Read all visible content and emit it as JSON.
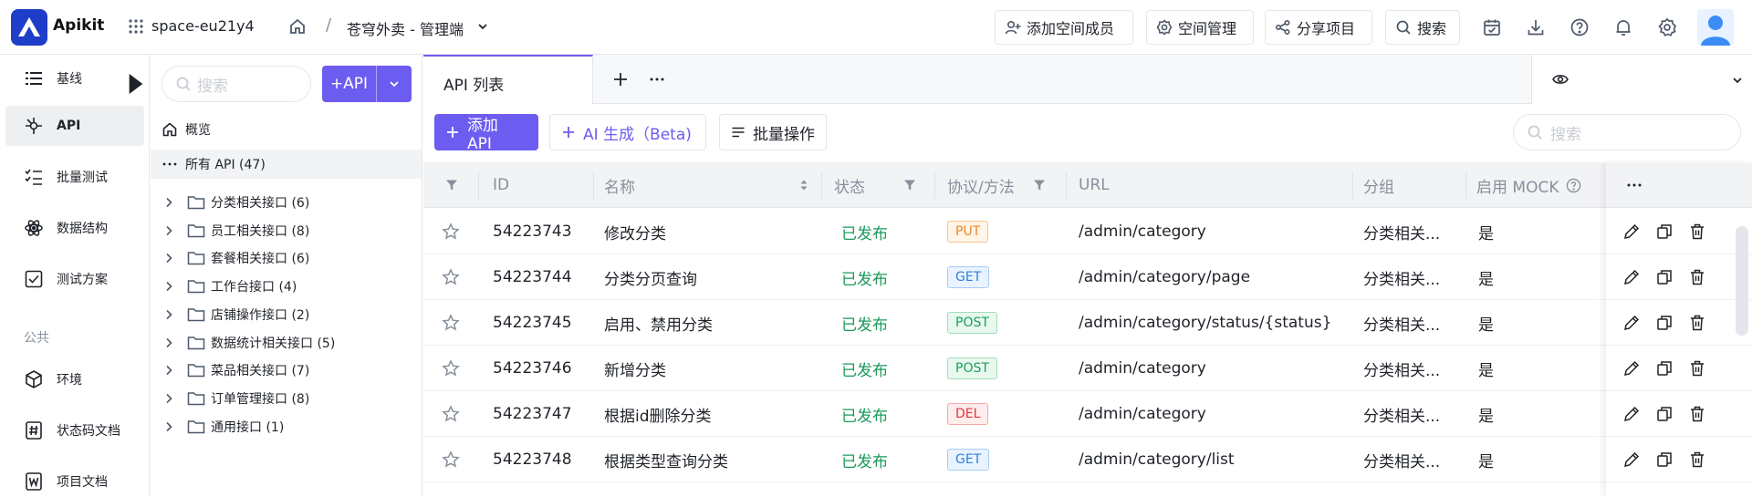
{
  "app": {
    "logo_text": "Apikit",
    "workspace": "space-eu21y4",
    "breadcrumb_sep": "/",
    "project": "苍穹外卖 - 管理端"
  },
  "top_actions": {
    "add_member": "添加空间成员",
    "space_manage": "空间管理",
    "share_project": "分享项目",
    "search": "搜索"
  },
  "top_icons": [
    "calendar-check-icon",
    "download-icon",
    "help-icon",
    "bell-icon",
    "gear-icon",
    "user-avatar-icon"
  ],
  "nav": {
    "items": [
      {
        "label": "基线",
        "icon": "baseline-icon"
      },
      {
        "label": "API",
        "icon": "api-icon",
        "active": true
      },
      {
        "label": "批量测试",
        "icon": "batch-test-icon"
      },
      {
        "label": "数据结构",
        "icon": "atom-icon"
      },
      {
        "label": "测试方案",
        "icon": "checklist-icon"
      }
    ],
    "section_public": "公共",
    "public_items": [
      {
        "label": "环境",
        "icon": "hexagon-icon"
      },
      {
        "label": "状态码文档",
        "icon": "hash-doc-icon"
      },
      {
        "label": "项目文档",
        "icon": "word-doc-icon"
      }
    ]
  },
  "tree": {
    "search_placeholder": "搜索",
    "add_label": "+API",
    "overview": "概览",
    "all_apis": "所有 API (47)",
    "folders": [
      "分类相关接口 (6)",
      "员工相关接口 (8)",
      "套餐相关接口 (6)",
      "工作台接口 (4)",
      "店铺操作接口 (2)",
      "数据统计相关接口 (5)",
      "菜品相关接口 (7)",
      "订单管理接口 (8)",
      "通用接口 (1)"
    ]
  },
  "tabs": {
    "active": "API 列表"
  },
  "toolbar": {
    "add_api": "添加 API",
    "ai_generate": "AI 生成（Beta)",
    "batch": "批量操作",
    "search_placeholder": "搜索"
  },
  "table": {
    "headers": {
      "id": "ID",
      "name": "名称",
      "status": "状态",
      "method": "协议/方法",
      "url": "URL",
      "group": "分组",
      "mock": "启用 MOCK"
    },
    "rows": [
      {
        "id": "54223743",
        "name": "修改分类",
        "status": "已发布",
        "method": "PUT",
        "url": "/admin/category",
        "group": "分类相关...",
        "mock": "是"
      },
      {
        "id": "54223744",
        "name": "分类分页查询",
        "status": "已发布",
        "method": "GET",
        "url": "/admin/category/page",
        "group": "分类相关...",
        "mock": "是"
      },
      {
        "id": "54223745",
        "name": "启用、禁用分类",
        "status": "已发布",
        "method": "POST",
        "url": "/admin/category/status/{status}",
        "group": "分类相关...",
        "mock": "是"
      },
      {
        "id": "54223746",
        "name": "新增分类",
        "status": "已发布",
        "method": "POST",
        "url": "/admin/category",
        "group": "分类相关...",
        "mock": "是"
      },
      {
        "id": "54223747",
        "name": "根据id删除分类",
        "status": "已发布",
        "method": "DEL",
        "url": "/admin/category",
        "group": "分类相关...",
        "mock": "是"
      },
      {
        "id": "54223748",
        "name": "根据类型查询分类",
        "status": "已发布",
        "method": "GET",
        "url": "/admin/category/list",
        "group": "分类相关...",
        "mock": "是"
      }
    ]
  },
  "colors": {
    "primary": "#6c5cf0",
    "status_published": "#1a9a5a",
    "PUT": "#e8892c",
    "GET": "#2f7fd6",
    "POST": "#1aa05a",
    "DEL": "#e0383e"
  }
}
